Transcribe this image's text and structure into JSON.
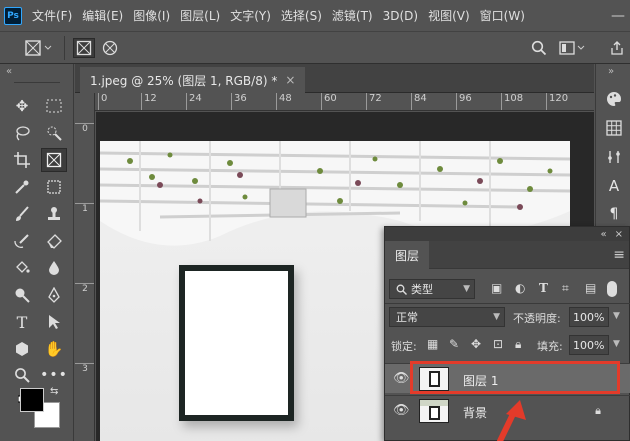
{
  "app": {
    "logo": "Ps",
    "minimize_symbol": "—"
  },
  "menu": [
    "文件(F)",
    "编辑(E)",
    "图像(I)",
    "图层(L)",
    "文字(Y)",
    "选择(S)",
    "滤镜(T)",
    "3D(D)",
    "视图(V)",
    "窗口(W)"
  ],
  "document": {
    "tab_title": "1.jpeg @ 25% (图层 1, RGB/8) *",
    "close_symbol": "×"
  },
  "ruler": {
    "h_ticks": [
      "0",
      "12",
      "24",
      "36",
      "48",
      "60",
      "72",
      "84",
      "96",
      "108",
      "120"
    ],
    "v_ticks": [
      "0",
      "1",
      "2",
      "3"
    ]
  },
  "layers_panel": {
    "collapse_symbol": "«",
    "close_symbol": "×",
    "tab_label": "图层",
    "filter_label": "类型",
    "blend_mode": "正常",
    "opacity_label": "不透明度:",
    "opacity_value": "100%",
    "lock_label": "锁定:",
    "fill_label": "填充:",
    "fill_value": "100%",
    "layers": [
      {
        "name": "图层 1",
        "selected": true
      },
      {
        "name": "背景",
        "locked": true
      }
    ]
  },
  "colors": {
    "annotation": "#e33b2a",
    "foreground": "#000000",
    "background": "#ffffff"
  }
}
